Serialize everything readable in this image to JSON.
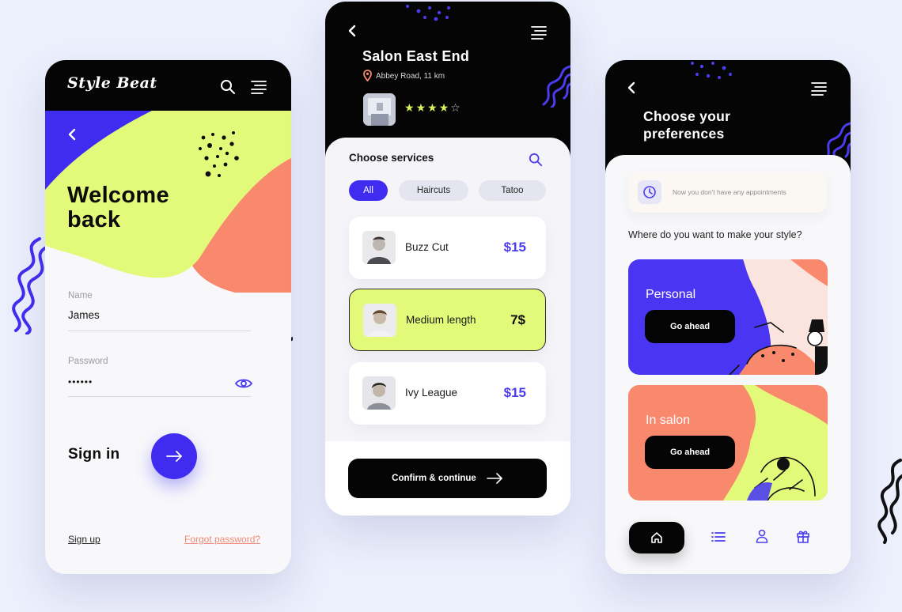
{
  "colors": {
    "background": "#eceffc",
    "black": "#050505",
    "accent_purple": "#3f2cf0",
    "lime": "#e2f97a",
    "coral": "#f9896d",
    "price_purple": "#4b3cf0",
    "link_coral": "#f08a76",
    "star_lime": "#d8f25c"
  },
  "login_screen": {
    "logo": "Style Beat",
    "heading_line1": "Welcome",
    "heading_line2": "back",
    "name_label": "Name",
    "name_value": "James",
    "password_label": "Password",
    "password_value": "••••••",
    "sign_in_label": "Sign in",
    "sign_up_link": "Sign up",
    "forgot_link": "Forgot password?",
    "icons": [
      "back-arrow-icon",
      "search-icon",
      "menu-icon",
      "eye-icon",
      "arrow-right-icon"
    ]
  },
  "services_screen": {
    "salon_name": "Salon East End",
    "address": "Abbey Road, 11 km",
    "rating": 4,
    "rating_max": 5,
    "section_title": "Choose services",
    "filters": [
      {
        "label": "All",
        "active": true
      },
      {
        "label": "Haircuts",
        "active": false
      },
      {
        "label": "Tatoo",
        "active": false
      }
    ],
    "services": [
      {
        "name": "Buzz Cut",
        "price": "$15",
        "selected": false
      },
      {
        "name": "Medium length",
        "price": "7$",
        "selected": true
      },
      {
        "name": "Ivy League",
        "price": "$15",
        "selected": false
      }
    ],
    "confirm_label": "Confirm & continue",
    "icons": [
      "back-arrow-icon",
      "menu-icon",
      "location-pin-icon",
      "star-icon",
      "search-icon",
      "arrow-right-icon"
    ]
  },
  "preferences_screen": {
    "title_line1": "Choose your",
    "title_line2": "preferences",
    "appointment_text": "Now you don't have any appointments",
    "question": "Where do you want to make your style?",
    "cards": [
      {
        "label": "Personal",
        "button": "Go ahead"
      },
      {
        "label": "In salon",
        "button": "Go ahead"
      }
    ],
    "nav_icons": [
      "home-icon",
      "list-icon",
      "profile-icon",
      "gift-icon"
    ]
  }
}
